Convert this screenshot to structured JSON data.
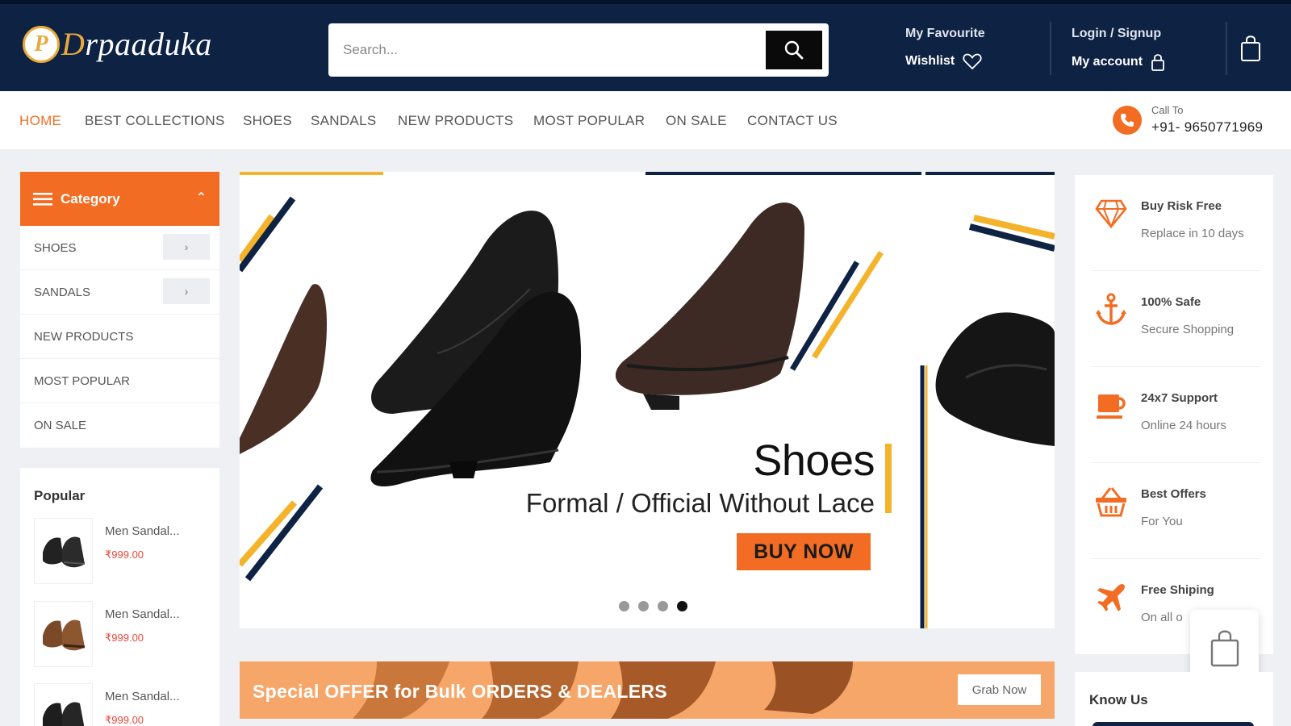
{
  "header": {
    "logo_badge": "P",
    "logo_first": "D",
    "logo_rest": "rpaaduka",
    "search_placeholder": "Search...",
    "favourite_label": "My Favourite",
    "wishlist_label": "Wishlist",
    "login_label": "Login / Signup",
    "account_label": "My account"
  },
  "nav": {
    "items": [
      "HOME",
      "BEST COLLECTIONS",
      "SHOES",
      "SANDALS",
      "NEW PRODUCTS",
      "MOST POPULAR",
      "ON SALE",
      "CONTACT US"
    ],
    "call_label": "Call To",
    "call_number": "+91- 9650771969"
  },
  "sidebar": {
    "category_title": "Category",
    "categories": [
      "SHOES",
      "SANDALS",
      "NEW PRODUCTS",
      "MOST POPULAR",
      "ON SALE"
    ],
    "popular_title": "Popular",
    "popular": [
      {
        "name": "Men Sandal...",
        "price": "₹999.00"
      },
      {
        "name": "Men Sandal...",
        "price": "₹999.00"
      },
      {
        "name": "Men Sandal...",
        "price": "₹999.00"
      }
    ]
  },
  "banner": {
    "heading": "Shoes",
    "subheading": "Formal / Official Without Lace",
    "cta": "BUY NOW",
    "slides": 4,
    "active_slide": 4
  },
  "offer": {
    "text": "Special OFFER for Bulk ORDERS & DEALERS",
    "button": "Grab Now"
  },
  "features": [
    {
      "title": "Buy Risk Free",
      "subtitle": "Replace in 10 days",
      "icon": "diamond-icon"
    },
    {
      "title": "100% Safe",
      "subtitle": "Secure Shopping",
      "icon": "anchor-icon"
    },
    {
      "title": "24x7 Support",
      "subtitle": "Online 24 hours",
      "icon": "cup-icon"
    },
    {
      "title": "Best Offers",
      "subtitle": "For You",
      "icon": "basket-icon"
    },
    {
      "title": "Free Shiping",
      "subtitle": "On all o",
      "icon": "airplane-icon"
    }
  ],
  "know_us": {
    "title": "Know Us"
  },
  "colors": {
    "navy": "#0e2244",
    "accent": "#f26d23",
    "gold": "#f4b32a",
    "price": "#e8483b"
  }
}
